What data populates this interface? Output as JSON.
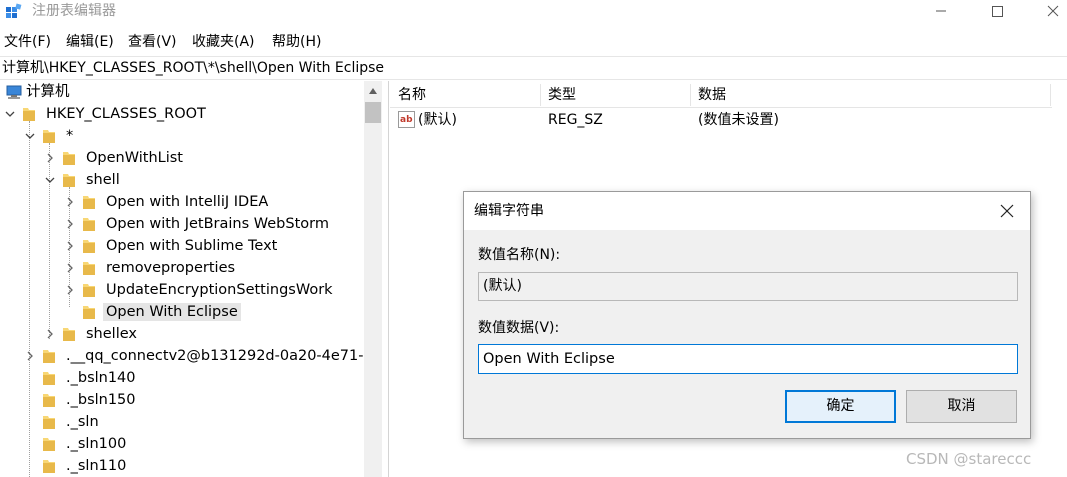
{
  "window": {
    "title": "注册表编辑器",
    "icon": "registry-editor-icon"
  },
  "menu": [
    {
      "label": "文件(F)"
    },
    {
      "label": "编辑(E)"
    },
    {
      "label": "查看(V)"
    },
    {
      "label": "收藏夹(A)"
    },
    {
      "label": "帮助(H)"
    }
  ],
  "address": "计算机\\HKEY_CLASSES_ROOT\\*\\shell\\Open With Eclipse",
  "tree": [
    {
      "label": "计算机",
      "icon": "computer-icon"
    },
    {
      "label": "HKEY_CLASSES_ROOT"
    },
    {
      "label": "*"
    },
    {
      "label": "OpenWithList"
    },
    {
      "label": "shell"
    },
    {
      "label": "Open with IntelliJ IDEA"
    },
    {
      "label": "Open with JetBrains WebStorm"
    },
    {
      "label": "Open with Sublime Text"
    },
    {
      "label": "removeproperties"
    },
    {
      "label": "UpdateEncryptionSettingsWork"
    },
    {
      "label": "Open With Eclipse",
      "selected": true
    },
    {
      "label": "shellex"
    },
    {
      "label": ".__qq_connectv2@b131292d-0a20-4e71-"
    },
    {
      "label": "._bsln140"
    },
    {
      "label": "._bsln150"
    },
    {
      "label": "._sln"
    },
    {
      "label": "._sln100"
    },
    {
      "label": "._sln110"
    }
  ],
  "list": {
    "columns": [
      "名称",
      "类型",
      "数据"
    ],
    "rows": [
      {
        "name": "(默认)",
        "type": "REG_SZ",
        "data": "(数值未设置)",
        "icon": "string-value-icon"
      }
    ]
  },
  "dialog": {
    "title": "编辑字符串",
    "name_label": "数值名称(N):",
    "name_value": "(默认)",
    "data_label": "数值数据(V):",
    "data_value": "Open With Eclipse",
    "ok_label": "确定",
    "cancel_label": "取消"
  },
  "watermark": "CSDN @stareccc",
  "colors": {
    "folder": "#f8d775",
    "accent": "#0078d7",
    "selection": "#e5e5e5"
  }
}
